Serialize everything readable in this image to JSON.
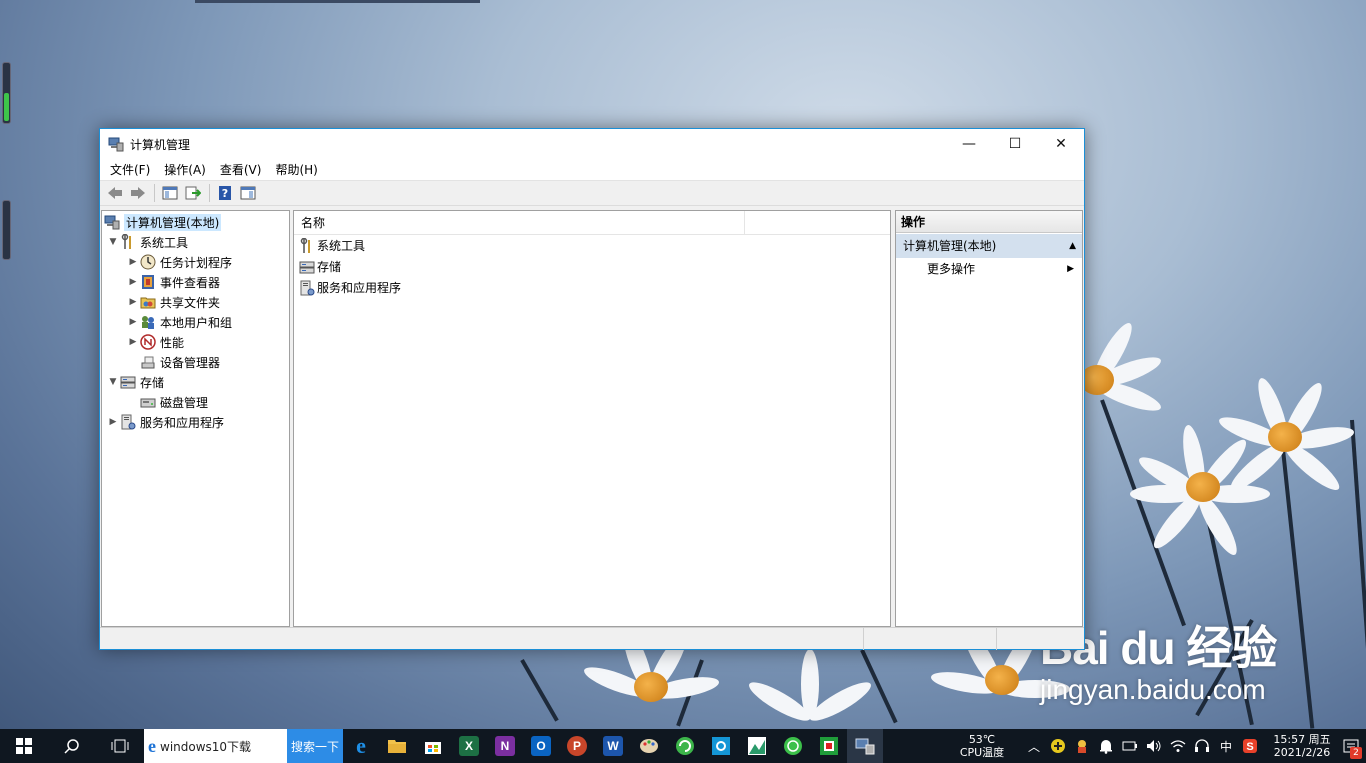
{
  "window": {
    "title": "计算机管理",
    "minimize_glyph": "—",
    "maximize_glyph": "☐",
    "close_glyph": "✕"
  },
  "menu": [
    "文件(F)",
    "操作(A)",
    "查看(V)",
    "帮助(H)"
  ],
  "toolbar": {
    "buttons": [
      "back-arrow-icon",
      "forward-arrow-icon",
      "show-hide-console-tree-icon",
      "export-list-icon",
      "help-icon",
      "show-hide-action-pane-icon"
    ]
  },
  "tree": {
    "root": "计算机管理(本地)",
    "items": [
      {
        "label": "系统工具",
        "expanded": true,
        "icon": "system-tools-icon"
      },
      {
        "label": "任务计划程序",
        "icon": "task-scheduler-icon"
      },
      {
        "label": "事件查看器",
        "icon": "event-viewer-icon"
      },
      {
        "label": "共享文件夹",
        "icon": "shared-folders-icon"
      },
      {
        "label": "本地用户和组",
        "icon": "local-users-icon"
      },
      {
        "label": "性能",
        "icon": "performance-icon"
      },
      {
        "label": "设备管理器",
        "icon": "device-manager-icon"
      },
      {
        "label": "存储",
        "expanded": true,
        "icon": "storage-icon"
      },
      {
        "label": "磁盘管理",
        "icon": "disk-management-icon"
      },
      {
        "label": "服务和应用程序",
        "icon": "services-apps-icon"
      }
    ]
  },
  "list": {
    "column_name": "名称",
    "rows": [
      "系统工具",
      "存储",
      "服务和应用程序"
    ]
  },
  "actions": {
    "header": "操作",
    "section": "计算机管理(本地)",
    "more": "更多操作"
  },
  "taskbar": {
    "search_text": "windows10下载",
    "search_button": "搜索一下",
    "temperature": "53℃",
    "temperature_label": "CPU温度",
    "ime": "中",
    "time": "15:57 周五",
    "date": "2021/2/26",
    "notification_count": "2",
    "app_letters": {
      "excel": "X",
      "onenote": "N",
      "outlook": "O",
      "powerpoint": "P",
      "word": "W"
    }
  },
  "watermark": {
    "logo": "Bai du 经验",
    "url": "jingyan.baidu.com"
  },
  "colors": {
    "accent": "#1b8fd6",
    "selection": "#cce8ff",
    "action_section": "#d3e0ee",
    "search_button": "#2d8ce6"
  }
}
